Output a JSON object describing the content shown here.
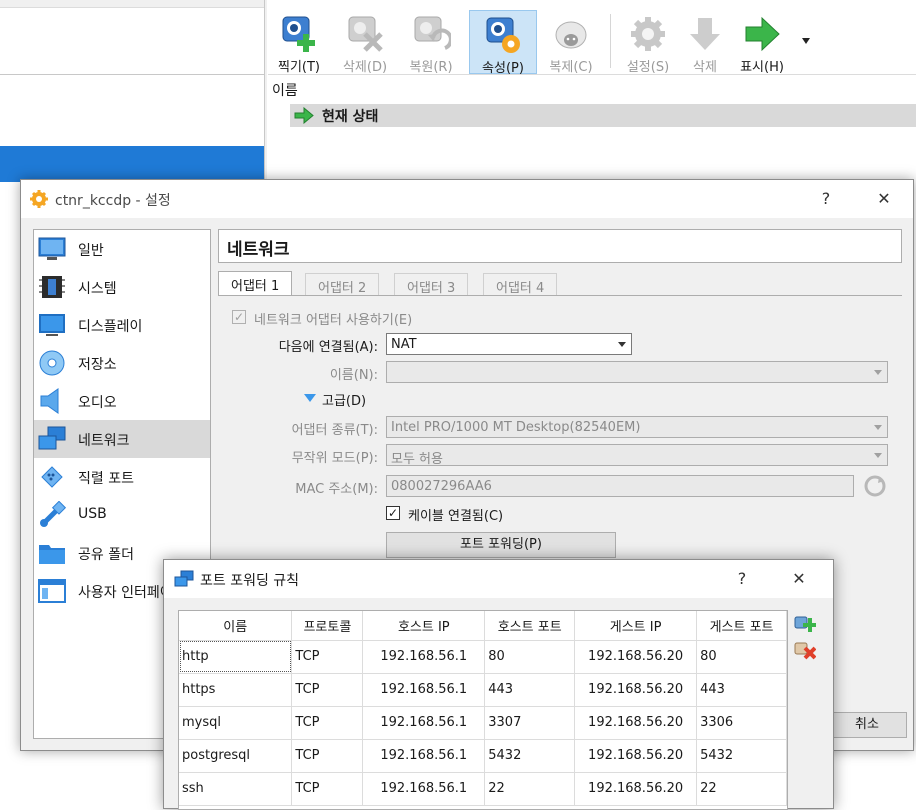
{
  "manager": {
    "toolbar": [
      {
        "label": "찍기(T)",
        "icon": "take-snapshot-icon",
        "state": "enabled"
      },
      {
        "label": "삭제(D)",
        "icon": "delete-snapshot-icon",
        "state": "disabled"
      },
      {
        "label": "복원(R)",
        "icon": "restore-snapshot-icon",
        "state": "disabled"
      },
      {
        "label": "속성(P)",
        "icon": "snapshot-properties-icon",
        "state": "active"
      },
      {
        "label": "복제(C)",
        "icon": "clone-icon",
        "state": "disabled"
      },
      {
        "label": "설정(S)",
        "icon": "settings-gear-icon",
        "state": "disabled"
      },
      {
        "label": "삭제",
        "icon": "discard-icon",
        "state": "disabled"
      },
      {
        "label": "표시(H)",
        "icon": "show-arrow-icon",
        "state": "enabled"
      }
    ],
    "snapshot_column": "이름",
    "current_state": "현재 상태"
  },
  "settings": {
    "title": "ctnr_kccdp - 설정",
    "help": "?",
    "close": "✕",
    "categories": [
      "일반",
      "시스템",
      "디스플레이",
      "저장소",
      "오디오",
      "네트워크",
      "직렬 포트",
      "USB",
      "공유 폴더",
      "사용자 인터페이스"
    ],
    "selected_category": "네트워크",
    "page_title": "네트워크",
    "tabs": [
      "어댑터 1",
      "어댑터 2",
      "어댑터 3",
      "어댑터 4"
    ],
    "enable_adapter": "네트워크 어댑터 사용하기(E)",
    "attached_to_label": "다음에 연결됨(A):",
    "attached_to_value": "NAT",
    "name_label": "이름(N):",
    "advanced_label": "고급(D)",
    "adapter_type_label": "어댑터 종류(T):",
    "adapter_type_value": "Intel PRO/1000 MT Desktop(82540EM)",
    "promisc_label": "무작위 모드(P):",
    "promisc_value": "모두 허용",
    "mac_label": "MAC 주소(M):",
    "mac_value": "080027296AA6",
    "cable_connected": "케이블 연결됨(C)",
    "port_forwarding_button": "포트 포워딩(P)",
    "cancel": "취소"
  },
  "port_forwarding": {
    "title": "포트 포워딩 규칙",
    "help": "?",
    "close": "✕",
    "columns": [
      "이름",
      "프로토콜",
      "호스트 IP",
      "호스트 포트",
      "게스트 IP",
      "게스트 포트"
    ],
    "rules": [
      {
        "name": "http",
        "protocol": "TCP",
        "host_ip": "192.168.56.1",
        "host_port": "80",
        "guest_ip": "192.168.56.20",
        "guest_port": "80"
      },
      {
        "name": "https",
        "protocol": "TCP",
        "host_ip": "192.168.56.1",
        "host_port": "443",
        "guest_ip": "192.168.56.20",
        "guest_port": "443"
      },
      {
        "name": "mysql",
        "protocol": "TCP",
        "host_ip": "192.168.56.1",
        "host_port": "3307",
        "guest_ip": "192.168.56.20",
        "guest_port": "3306"
      },
      {
        "name": "postgresql",
        "protocol": "TCP",
        "host_ip": "192.168.56.1",
        "host_port": "5432",
        "guest_ip": "192.168.56.20",
        "guest_port": "5432"
      },
      {
        "name": "ssh",
        "protocol": "TCP",
        "host_ip": "192.168.56.1",
        "host_port": "22",
        "guest_ip": "192.168.56.20",
        "guest_port": "22"
      }
    ]
  }
}
